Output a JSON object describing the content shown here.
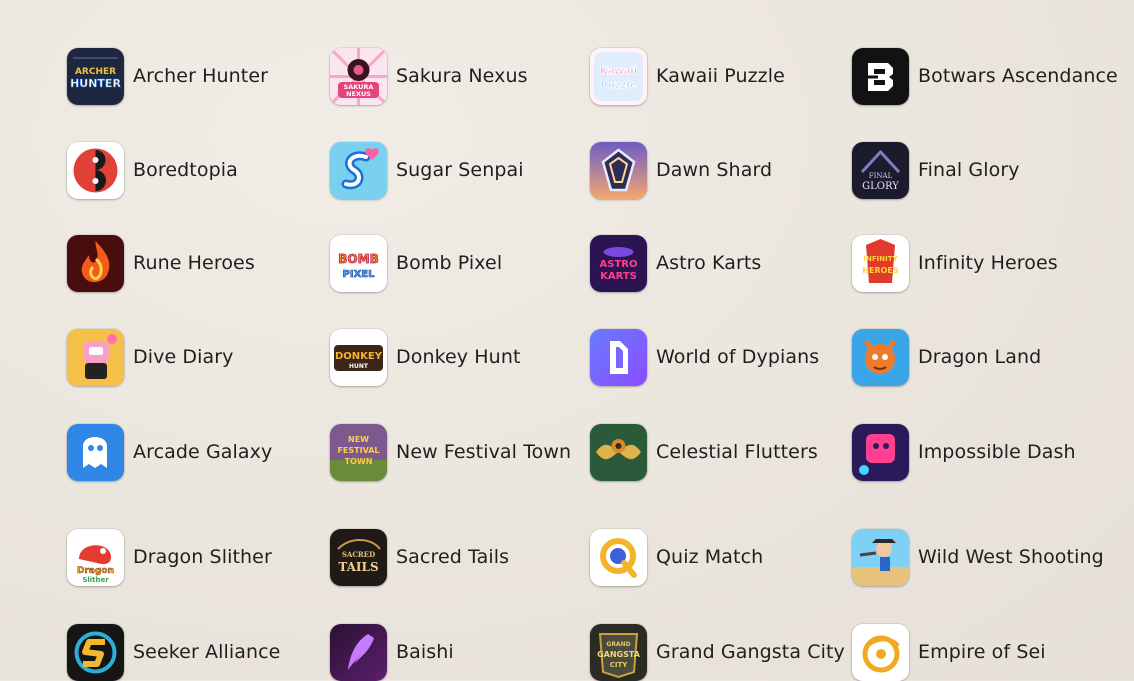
{
  "apps": [
    {
      "name": "Archer Hunter",
      "icon": "archer-hunter-icon"
    },
    {
      "name": "Sakura Nexus",
      "icon": "sakura-nexus-icon"
    },
    {
      "name": "Kawaii Puzzle",
      "icon": "kawaii-puzzle-icon"
    },
    {
      "name": "Botwars Ascendance",
      "icon": "botwars-icon"
    },
    {
      "name": "Boredtopia",
      "icon": "boredtopia-icon"
    },
    {
      "name": "Sugar Senpai",
      "icon": "sugar-senpai-icon"
    },
    {
      "name": "Dawn Shard",
      "icon": "dawn-shard-icon"
    },
    {
      "name": "Final Glory",
      "icon": "final-glory-icon"
    },
    {
      "name": "Rune Heroes",
      "icon": "rune-heroes-icon"
    },
    {
      "name": "Bomb Pixel",
      "icon": "bomb-pixel-icon"
    },
    {
      "name": "Astro Karts",
      "icon": "astro-karts-icon"
    },
    {
      "name": "Infinity Heroes",
      "icon": "infinity-heroes-icon"
    },
    {
      "name": "Dive Diary",
      "icon": "dive-diary-icon"
    },
    {
      "name": "Donkey Hunt",
      "icon": "donkey-hunt-icon"
    },
    {
      "name": "World of Dypians",
      "icon": "world-of-dypians-icon"
    },
    {
      "name": "Dragon Land",
      "icon": "dragon-land-icon"
    },
    {
      "name": "Arcade Galaxy",
      "icon": "arcade-galaxy-icon"
    },
    {
      "name": "New Festival Town",
      "icon": "new-festival-town-icon"
    },
    {
      "name": "Celestial Flutters",
      "icon": "celestial-flutters-icon"
    },
    {
      "name": "Impossible Dash",
      "icon": "impossible-dash-icon"
    },
    {
      "name": "Dragon Slither",
      "icon": "dragon-slither-icon"
    },
    {
      "name": "Sacred Tails",
      "icon": "sacred-tails-icon"
    },
    {
      "name": "Quiz Match",
      "icon": "quiz-match-icon"
    },
    {
      "name": "Wild West Shooting",
      "icon": "wild-west-shooting-icon"
    },
    {
      "name": "Seeker Alliance",
      "icon": "seeker-alliance-icon"
    },
    {
      "name": "Baishi",
      "icon": "baishi-icon"
    },
    {
      "name": "Grand Gangsta City",
      "icon": "grand-gangsta-city-icon"
    },
    {
      "name": "Empire of Sei",
      "icon": "empire-of-sei-icon"
    }
  ],
  "icon_logo_text": {
    "archer-hunter-icon": [
      "ARCHER",
      "HUNTER"
    ],
    "sakura-nexus-icon": [
      "SAKURA",
      "NEXUS"
    ],
    "kawaii-puzzle-icon": [
      "Kawaii",
      "Puzzle"
    ],
    "final-glory-icon": [
      "FINAL",
      "GLORY"
    ],
    "bomb-pixel-icon": [
      "BOMB",
      "PIXEL"
    ],
    "astro-karts-icon": [
      "ASTRO",
      "KARTS"
    ],
    "infinity-heroes-icon": [
      "INFINITY",
      "HEROES"
    ],
    "donkey-hunt-icon": [
      "DONKEY",
      "HUNT"
    ],
    "new-festival-town-icon": [
      "NEW",
      "FESTIVAL",
      "TOWN"
    ],
    "dragon-slither-icon": [
      "Dragon",
      "Slither"
    ],
    "sacred-tails-icon": [
      "SACRED",
      "TAILS"
    ],
    "grand-gangsta-city-icon": [
      "GRAND",
      "GANGSTA",
      "CITY"
    ]
  }
}
